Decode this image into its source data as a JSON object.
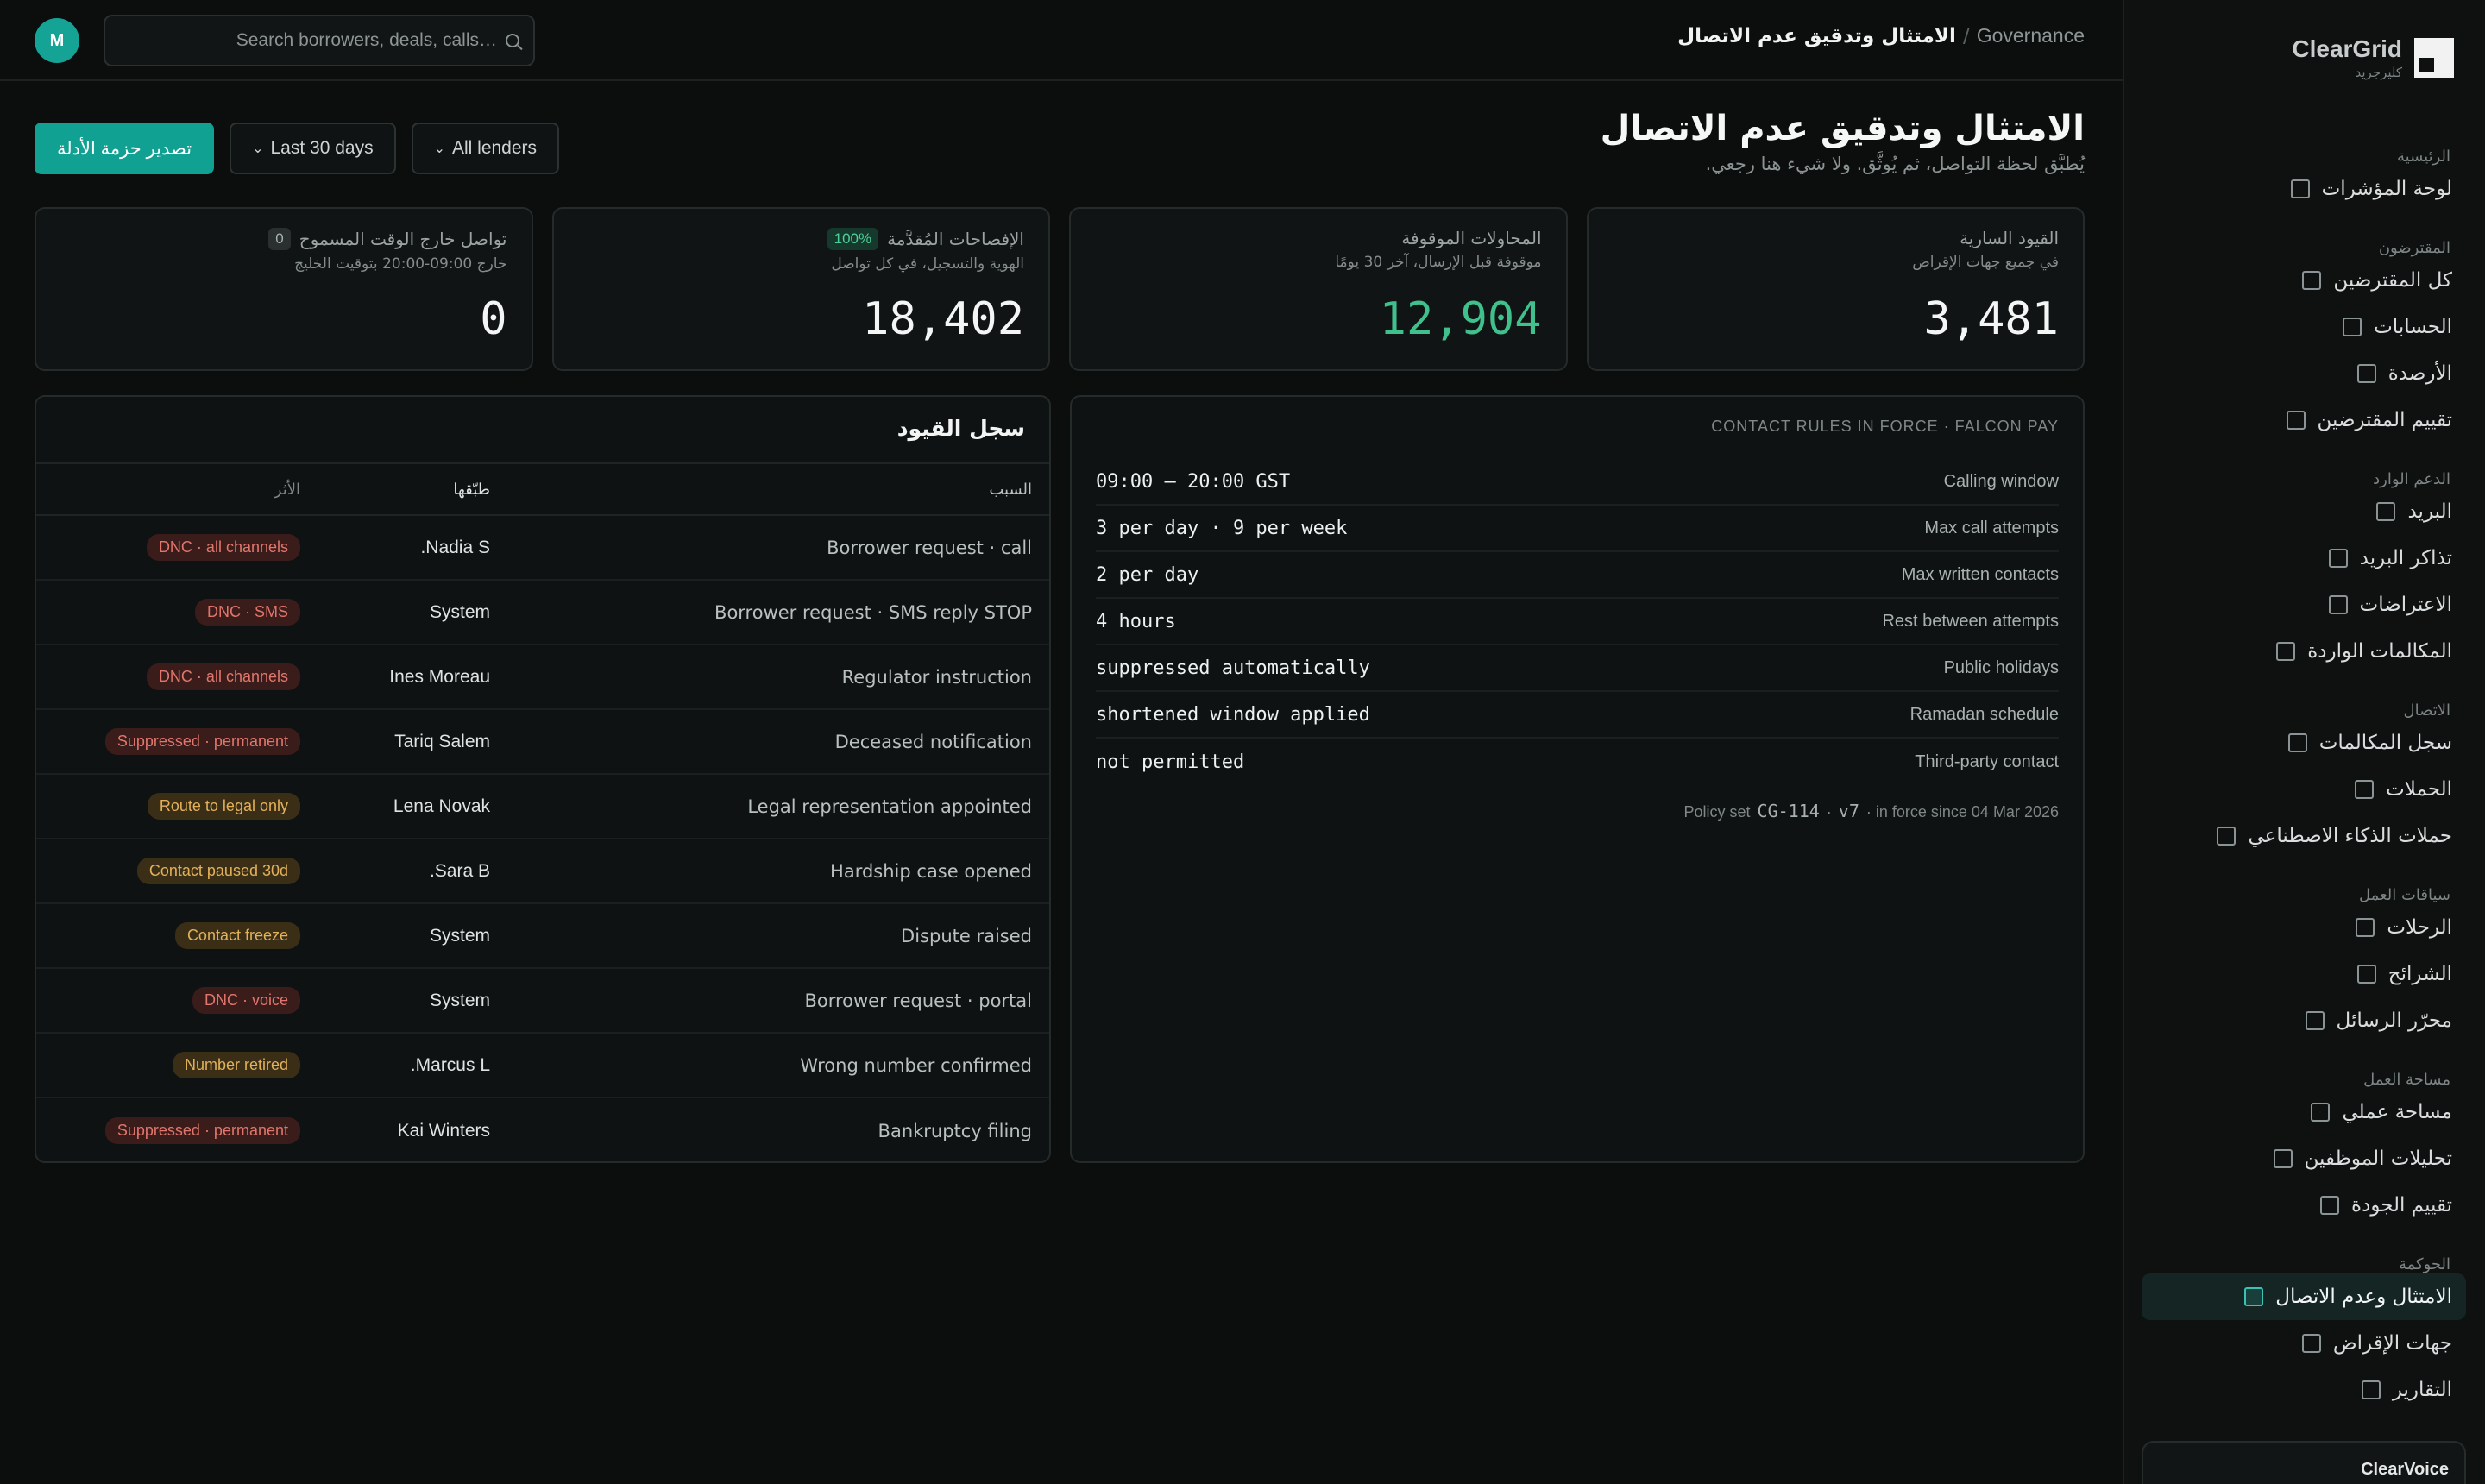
{
  "brand": {
    "name": "ClearGrid",
    "sub": "كليرجريد"
  },
  "sidebar": {
    "groups": [
      {
        "title": "الرئيسية",
        "items": [
          {
            "label": "لوحة المؤشرات"
          }
        ]
      },
      {
        "title": "المقترضون",
        "items": [
          {
            "label": "كل المقترضين"
          },
          {
            "label": "الحسابات"
          },
          {
            "label": "الأرصدة"
          },
          {
            "label": "تقييم المقترضين"
          }
        ]
      },
      {
        "title": "الدعم الوارد",
        "items": [
          {
            "label": "البريد"
          },
          {
            "label": "تذاكر البريد"
          },
          {
            "label": "الاعتراضات"
          },
          {
            "label": "المكالمات الواردة"
          }
        ]
      },
      {
        "title": "الاتصال",
        "items": [
          {
            "label": "سجل المكالمات"
          },
          {
            "label": "الحملات"
          },
          {
            "label": "حملات الذكاء الاصطناعي"
          }
        ]
      },
      {
        "title": "سياقات العمل",
        "items": [
          {
            "label": "الرحلات"
          },
          {
            "label": "الشرائح"
          },
          {
            "label": "محرّر الرسائل"
          }
        ]
      },
      {
        "title": "مساحة العمل",
        "items": [
          {
            "label": "مساحة عملي"
          },
          {
            "label": "تحليلات الموظفين"
          },
          {
            "label": "تقييم الجودة"
          }
        ]
      },
      {
        "title": "الحوكمة",
        "items": [
          {
            "label": "الامتثال وعدم الاتصال",
            "active": true
          },
          {
            "label": "جهات الإقراض"
          },
          {
            "label": "التقارير"
          }
        ]
      }
    ],
    "footer": "ClearVoice"
  },
  "topbar": {
    "breadcrumb_parent": "Governance",
    "breadcrumb_sep": "/",
    "breadcrumb_current": "الامتثال وتدقيق عدم الاتصال",
    "search_placeholder": "Search borrowers, deals, calls…",
    "avatar_initial": "M"
  },
  "header": {
    "title": "الامتثال وتدقيق عدم الاتصال",
    "subtitle": "يُطبَّق لحظة التواصل، ثم يُوثَّق. ولا شيء هنا رجعي."
  },
  "actions": {
    "lenders": "All lenders",
    "range": "Last 30 days",
    "export": "تصدير حزمة الأدلة"
  },
  "kpis": [
    {
      "title": "القيود السارية",
      "sub": "في جميع جهات الإقراض",
      "value": "3,481",
      "badge": ""
    },
    {
      "title": "المحاولات الموقوفة",
      "sub": "موقوفة قبل الإرسال، آخر 30 يومًا",
      "value": "12,904",
      "badge": "",
      "color": "#3fc08c"
    },
    {
      "title": "الإفصاحات المُقدَّمة",
      "sub": "الهوية والتسجيل، في كل تواصل",
      "value": "18,402",
      "badge": "100%"
    },
    {
      "title": "تواصل خارج الوقت المسموح",
      "sub": "خارج 09:00-20:00 بتوقيت الخليج",
      "value": "0",
      "badge": "0"
    }
  ],
  "log": {
    "title": "سجل القيود",
    "columns": {
      "reason": "السبب",
      "by": "طبّقها",
      "effect": "الأثر"
    },
    "rows": [
      {
        "reason": "Borrower request · call",
        "by": "Nadia S.",
        "effect": "DNC · all channels",
        "tone": "red"
      },
      {
        "reason": "Borrower request · SMS reply STOP",
        "by": "System",
        "effect": "DNC · SMS",
        "tone": "red"
      },
      {
        "reason": "Regulator instruction",
        "by": "Ines Moreau",
        "effect": "DNC · all channels",
        "tone": "red"
      },
      {
        "reason": "Deceased notification",
        "by": "Tariq Salem",
        "effect": "Suppressed · permanent",
        "tone": "red"
      },
      {
        "reason": "Legal representation appointed",
        "by": "Lena Novak",
        "effect": "Route to legal only",
        "tone": "amber"
      },
      {
        "reason": "Hardship case opened",
        "by": "Sara B.",
        "effect": "Contact paused 30d",
        "tone": "amber"
      },
      {
        "reason": "Dispute raised",
        "by": "System",
        "effect": "Contact freeze",
        "tone": "amber"
      },
      {
        "reason": "Borrower request · portal",
        "by": "System",
        "effect": "DNC · voice",
        "tone": "red"
      },
      {
        "reason": "Wrong number confirmed",
        "by": "Marcus L.",
        "effect": "Number retired",
        "tone": "amber"
      },
      {
        "reason": "Bankruptcy filing",
        "by": "Kai Winters",
        "effect": "Suppressed · permanent",
        "tone": "red"
      }
    ]
  },
  "rules": {
    "title": "CONTACT RULES IN FORCE · FALCON PAY",
    "items": [
      {
        "label": "Calling window",
        "value": "09:00 – 20:00 GST"
      },
      {
        "label": "Max call attempts",
        "value": "3 per day · 9 per week"
      },
      {
        "label": "Max written contacts",
        "value": "2 per day"
      },
      {
        "label": "Rest between attempts",
        "value": "4 hours"
      },
      {
        "label": "Public holidays",
        "value": "suppressed automatically"
      },
      {
        "label": "Ramadan schedule",
        "value": "shortened window applied"
      },
      {
        "label": "Third-party contact",
        "value": "not permitted"
      }
    ],
    "policy_prefix": "Policy set",
    "policy_id": "CG-114",
    "policy_dot": "·",
    "policy_version": "v7",
    "policy_since": "· in force since 04 Mar 2026"
  },
  "colors": {
    "accent": "#11a192",
    "positive": "#3fc08c",
    "danger": "#e1766c",
    "warning": "#e3b15a"
  },
  "icons": {
    "search": "search-icon",
    "chevron": "chevron-down-icon",
    "brand": "brand-logo-icon"
  }
}
